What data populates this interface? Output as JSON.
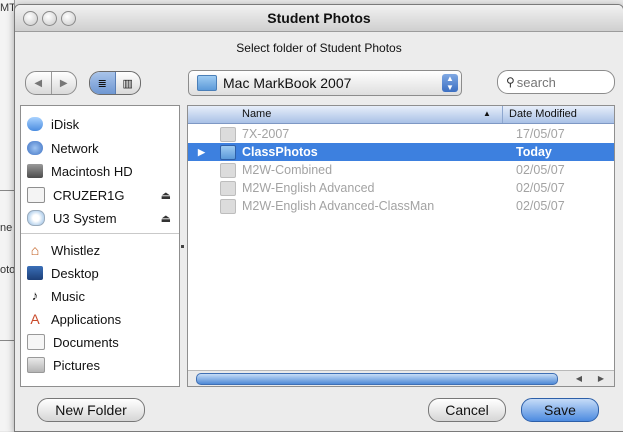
{
  "background_window": {
    "fragments": [
      "MT",
      "ne",
      "oto"
    ]
  },
  "dialog": {
    "title": "Student Photos",
    "prompt": "Select folder of Student Photos",
    "location_popup": "Mac MarkBook 2007",
    "search_placeholder": "search"
  },
  "sidebar": {
    "devices": [
      {
        "label": "iDisk",
        "icon": "idisk-icon"
      },
      {
        "label": "Network",
        "icon": "network-icon"
      },
      {
        "label": "Macintosh HD",
        "icon": "hard-drive-icon"
      },
      {
        "label": "CRUZER1G",
        "icon": "usb-drive-icon",
        "eject": "⏏"
      },
      {
        "label": "U3 System",
        "icon": "cd-icon",
        "eject": "⏏"
      }
    ],
    "places": [
      {
        "label": "Whistlez",
        "icon": "home-icon"
      },
      {
        "label": "Desktop",
        "icon": "desktop-icon"
      },
      {
        "label": "Music",
        "icon": "music-icon"
      },
      {
        "label": "Applications",
        "icon": "applications-icon"
      },
      {
        "label": "Documents",
        "icon": "documents-icon"
      },
      {
        "label": "Pictures",
        "icon": "pictures-icon"
      }
    ]
  },
  "browser": {
    "columns": {
      "name": "Name",
      "date": "Date Modified"
    },
    "rows": [
      {
        "name": "7X-2007",
        "date": "17/05/07"
      },
      {
        "name": "ClassPhotos",
        "date": "Today",
        "selected": true
      },
      {
        "name": "M2W-Combined",
        "date": "02/05/07"
      },
      {
        "name": "M2W-English Advanced",
        "date": "02/05/07"
      },
      {
        "name": "M2W-English Advanced-ClassMan",
        "date": "02/05/07"
      }
    ]
  },
  "buttons": {
    "new_folder": "New Folder",
    "cancel": "Cancel",
    "save": "Save"
  },
  "colors": {
    "selection": "#3d80df",
    "default_button": "#4d8be0"
  }
}
